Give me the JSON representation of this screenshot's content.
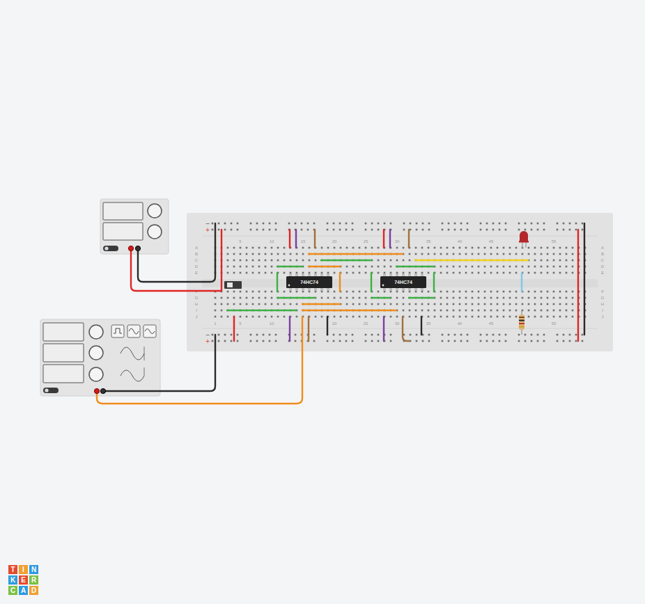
{
  "logo": [
    {
      "letter": "T",
      "color": "#e64a2e"
    },
    {
      "letter": "I",
      "color": "#f0a030"
    },
    {
      "letter": "N",
      "color": "#2e9be0"
    },
    {
      "letter": "K",
      "color": "#2e9be0"
    },
    {
      "letter": "E",
      "color": "#e64a2e"
    },
    {
      "letter": "R",
      "color": "#7ac143"
    },
    {
      "letter": "C",
      "color": "#7ac143"
    },
    {
      "letter": "A",
      "color": "#2e9be0"
    },
    {
      "letter": "D",
      "color": "#f0a030"
    }
  ],
  "breadboard": {
    "columns_top": [
      "5",
      "10",
      "15",
      "20",
      "25",
      "30",
      "35",
      "40",
      "45",
      "55"
    ],
    "columns_bottom": [
      "1",
      "5",
      "10",
      "20",
      "25",
      "30",
      "35",
      "40",
      "45",
      "55"
    ],
    "rows_top": [
      "A",
      "B",
      "C",
      "D",
      "E"
    ],
    "rows_bottom": [
      "F",
      "G",
      "H",
      "I",
      "J"
    ],
    "rail_minus": "−",
    "rail_plus": "+"
  },
  "chips": [
    {
      "label": "74HC74"
    },
    {
      "label": "74HC74"
    }
  ],
  "led": {
    "color": "#b3262a",
    "lit": false
  },
  "resistor": {
    "bands": [
      {
        "color": "#8b4513"
      },
      {
        "color": "#222222"
      },
      {
        "color": "#c0392b"
      },
      {
        "color": "#d4a017"
      }
    ]
  },
  "wires": [
    {
      "color": "#2a2a2a"
    },
    {
      "color": "#e02424"
    },
    {
      "color": "#e02424"
    },
    {
      "color": "#7b3fa0"
    },
    {
      "color": "#a0703c"
    },
    {
      "color": "#e02424"
    },
    {
      "color": "#7b3fa0"
    },
    {
      "color": "#a0703c"
    },
    {
      "color": "#f08c1a"
    },
    {
      "color": "#3cb043"
    },
    {
      "color": "#f08c1a"
    },
    {
      "color": "#3cb043"
    },
    {
      "color": "#f2d21b"
    },
    {
      "color": "#3cb043"
    },
    {
      "color": "#3cb043"
    },
    {
      "color": "#f08c1a"
    },
    {
      "color": "#3cb043"
    },
    {
      "color": "#3cb043"
    },
    {
      "color": "#3cb043"
    },
    {
      "color": "#f08c1a"
    },
    {
      "color": "#3cb043"
    },
    {
      "color": "#f08c1a"
    },
    {
      "color": "#3cb043"
    },
    {
      "color": "#3cb043"
    },
    {
      "color": "#e02424"
    },
    {
      "color": "#7b3fa0"
    },
    {
      "color": "#f08c1a"
    },
    {
      "color": "#a0703c"
    },
    {
      "color": "#2a2a2a"
    },
    {
      "color": "#7b3fa0"
    },
    {
      "color": "#a0703c"
    },
    {
      "color": "#2a2a2a"
    },
    {
      "color": "#2a2a2a"
    },
    {
      "color": "#e02424"
    },
    {
      "color": "#2a2a2a"
    },
    {
      "color": "#7ec8e3"
    }
  ]
}
